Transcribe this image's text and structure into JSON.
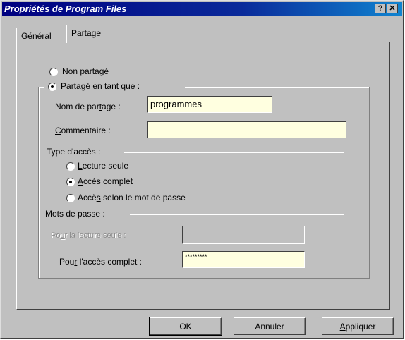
{
  "window": {
    "title": "Propriétés de Program Files",
    "help_label": "?",
    "close_label": "✕"
  },
  "tabs": [
    {
      "label": "Général",
      "active": false
    },
    {
      "label": "Partage",
      "active": true
    }
  ],
  "sharing": {
    "not_shared": {
      "mnemonic": "N",
      "rest": "on partagé",
      "selected": false
    },
    "shared_as": {
      "mnemonic": "P",
      "rest": "artagé en tant que :",
      "selected": true
    },
    "share_name": {
      "pre": "Nom de par",
      "mnemonic": "t",
      "post": "age :",
      "value": "programmes"
    },
    "comment": {
      "mnemonic": "C",
      "rest": "ommentaire :",
      "value": ""
    }
  },
  "access_type": {
    "label": "Type d'accès :",
    "options": [
      {
        "pre": "",
        "mnemonic": "L",
        "post": "ecture seule",
        "selected": false
      },
      {
        "pre": "",
        "mnemonic": "A",
        "post": "ccès complet",
        "selected": true
      },
      {
        "pre": "Accè",
        "mnemonic": "s",
        "post": " selon le mot de passe",
        "selected": false
      }
    ]
  },
  "passwords": {
    "label": "Mots de passe :",
    "read_only": {
      "pre": "Po",
      "mnemonic": "u",
      "post": "r la lecture seule :",
      "value": "",
      "enabled": false
    },
    "full_access": {
      "pre": "Pou",
      "mnemonic": "r",
      "post": " l'accès complet :",
      "value": "*********",
      "enabled": true
    }
  },
  "buttons": {
    "ok": "OK",
    "cancel": "Annuler",
    "apply_mnemonic": "A",
    "apply_rest": "ppliquer"
  }
}
